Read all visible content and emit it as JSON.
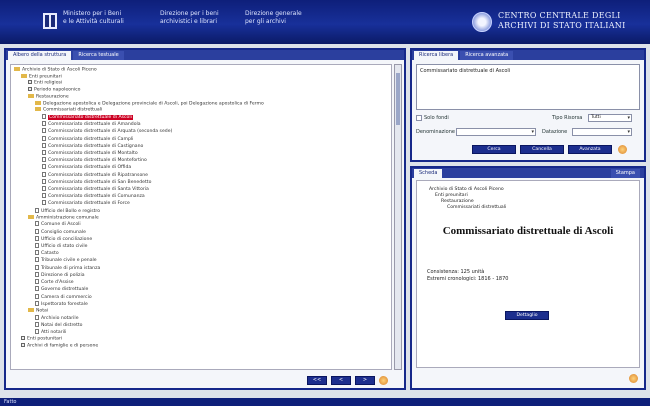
{
  "header": {
    "nav1": [
      "Ministero per i Beni",
      "e le Attività culturali"
    ],
    "nav2": [
      "Direzione per i beni",
      "archivistici e librari"
    ],
    "nav3": [
      "Direzione generale",
      "per gli archivi"
    ],
    "brand": [
      "CENTRO CENTRALE DEGLI",
      "ARCHIVI DI STATO ITALIANI"
    ]
  },
  "left_panel": {
    "tabs": [
      "Albero della struttura",
      "Ricerca testuale"
    ],
    "tree": [
      {
        "indent": 0,
        "kind": "fd",
        "text": "Archivio di Stato di Ascoli Piceno"
      },
      {
        "indent": 1,
        "kind": "fd",
        "text": "Enti preunitari"
      },
      {
        "indent": 2,
        "kind": "ic",
        "text": "Enti religiosi"
      },
      {
        "indent": 2,
        "kind": "ic",
        "text": "Periodo napoleonico"
      },
      {
        "indent": 2,
        "kind": "fd",
        "text": "Restaurazione"
      },
      {
        "indent": 3,
        "kind": "fd",
        "text": "Delegazione apostolica e Delegazione provinciale di Ascoli, poi Delegazione apostolica di Fermo"
      },
      {
        "indent": 3,
        "kind": "fd",
        "text": "Commissariati distrettuali"
      },
      {
        "indent": 4,
        "kind": "dc",
        "text": "Commissariato distrettuale di Ascoli",
        "selected": true
      },
      {
        "indent": 4,
        "kind": "dc",
        "text": "Commissariato distrettuale di Amandola"
      },
      {
        "indent": 4,
        "kind": "dc",
        "text": "Commissariato distrettuale di Arquata (seconda sede)"
      },
      {
        "indent": 4,
        "kind": "dc",
        "text": "Commissariato distrettuale di Campli"
      },
      {
        "indent": 4,
        "kind": "dc",
        "text": "Commissariato distrettuale di Castignano"
      },
      {
        "indent": 4,
        "kind": "dc",
        "text": "Commissariato distrettuale di Montalto"
      },
      {
        "indent": 4,
        "kind": "dc",
        "text": "Commissariato distrettuale di Montefortino"
      },
      {
        "indent": 4,
        "kind": "dc",
        "text": "Commissariato distrettuale di Offida"
      },
      {
        "indent": 4,
        "kind": "dc",
        "text": "Commissariato distrettuale di Ripatransone"
      },
      {
        "indent": 4,
        "kind": "dc",
        "text": "Commissariato distrettuale di San Benedetto"
      },
      {
        "indent": 4,
        "kind": "dc",
        "text": "Commissariato distrettuale di Santa Vittoria"
      },
      {
        "indent": 4,
        "kind": "dc",
        "text": "Commissariato distrettuale di Comunanza"
      },
      {
        "indent": 4,
        "kind": "dc",
        "text": "Commissariato distrettuale di Force"
      },
      {
        "indent": 3,
        "kind": "dc",
        "text": "Ufficio del Bollo e registro"
      },
      {
        "indent": 2,
        "kind": "fd",
        "text": "Amministrazione comunale"
      },
      {
        "indent": 3,
        "kind": "dc",
        "text": "Comune di Ascoli"
      },
      {
        "indent": 3,
        "kind": "dc",
        "text": "Consiglio comunale"
      },
      {
        "indent": 3,
        "kind": "dc",
        "text": "Ufficio di conciliazione"
      },
      {
        "indent": 3,
        "kind": "dc",
        "text": "Ufficio di stato civile"
      },
      {
        "indent": 3,
        "kind": "dc",
        "text": "Catasto"
      },
      {
        "indent": 3,
        "kind": "dc",
        "text": "Tribunale civile e penale"
      },
      {
        "indent": 3,
        "kind": "dc",
        "text": "Tribunale di prima istanza"
      },
      {
        "indent": 3,
        "kind": "dc",
        "text": "Direzione di polizia"
      },
      {
        "indent": 3,
        "kind": "dc",
        "text": "Corte d'Assise"
      },
      {
        "indent": 3,
        "kind": "dc",
        "text": "Governo distrettuale"
      },
      {
        "indent": 3,
        "kind": "dc",
        "text": "Camera di commercio"
      },
      {
        "indent": 3,
        "kind": "dc",
        "text": "Ispettorato forestale"
      },
      {
        "indent": 2,
        "kind": "fd",
        "text": "Notai"
      },
      {
        "indent": 3,
        "kind": "dc",
        "text": "Archivio notarile"
      },
      {
        "indent": 3,
        "kind": "dc",
        "text": "Notai del distretto"
      },
      {
        "indent": 3,
        "kind": "dc",
        "text": "Atti notarili"
      },
      {
        "indent": 1,
        "kind": "ic",
        "text": "Enti postunitari"
      },
      {
        "indent": 1,
        "kind": "ic",
        "text": "Archivi di famiglie e di persone"
      }
    ],
    "buttons": [
      "<<",
      "<",
      ">"
    ]
  },
  "right_top": {
    "tabs": [
      "Ricerca libera",
      "Ricerca avanzata"
    ],
    "query": "Commissariato distrettuale di Ascoli",
    "checkbox_label": "Solo fondi",
    "filter1_label": "Tipo Risorsa",
    "filter1_value": "Tutti",
    "filter2_label": "Denominazione",
    "filter2_value": "",
    "filter3_label": "Datazione",
    "filter3_value": "",
    "buttons": [
      "Cerca",
      "Cancella",
      "Avanzata"
    ]
  },
  "right_bottom": {
    "tabs": [
      "Scheda",
      "Stampa"
    ],
    "breadcrumb": [
      "Archivio di Stato di Ascoli Piceno",
      "Enti preunitari",
      "Restaurazione",
      "Commissariati distrettuali"
    ],
    "title": "Commissariato distrettuale di Ascoli",
    "meta1": "Consistenza: 125 unità",
    "meta2": "Estremi cronologici: 1816 - 1870",
    "button": "Dettaglio"
  },
  "status": "Fatto"
}
